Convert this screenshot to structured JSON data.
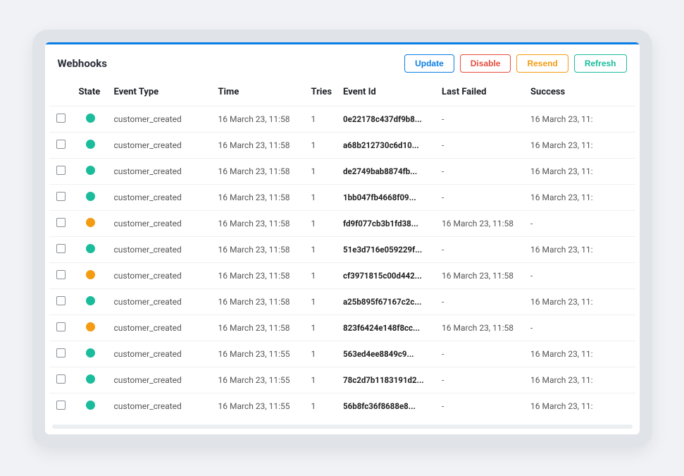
{
  "title": "Webhooks",
  "actions": {
    "update": "Update",
    "disable": "Disable",
    "resend": "Resend",
    "refresh": "Refresh"
  },
  "columns": {
    "state": "State",
    "event_type": "Event Type",
    "time": "Time",
    "tries": "Tries",
    "event_id": "Event Id",
    "last_failed": "Last Failed",
    "success": "Success"
  },
  "rows": [
    {
      "state": "teal",
      "event_type": "customer_created",
      "time": "16 March 23, 11:58",
      "tries": "1",
      "event_id": "0e22178c437df9b8...",
      "last_failed": "-",
      "success": "16 March 23, 11:"
    },
    {
      "state": "teal",
      "event_type": "customer_created",
      "time": "16 March 23, 11:58",
      "tries": "1",
      "event_id": "a68b212730c6d10...",
      "last_failed": "-",
      "success": "16 March 23, 11:"
    },
    {
      "state": "teal",
      "event_type": "customer_created",
      "time": "16 March 23, 11:58",
      "tries": "1",
      "event_id": "de2749bab8874fb...",
      "last_failed": "-",
      "success": "16 March 23, 11:"
    },
    {
      "state": "teal",
      "event_type": "customer_created",
      "time": "16 March 23, 11:58",
      "tries": "1",
      "event_id": "1bb047fb4668f09...",
      "last_failed": "-",
      "success": "16 March 23, 11:"
    },
    {
      "state": "orange",
      "event_type": "customer_created",
      "time": "16 March 23, 11:58",
      "tries": "1",
      "event_id": "fd9f077cb3b1fd38...",
      "last_failed": "16 March 23, 11:58",
      "success": "-"
    },
    {
      "state": "teal",
      "event_type": "customer_created",
      "time": "16 March 23, 11:58",
      "tries": "1",
      "event_id": "51e3d716e059229f...",
      "last_failed": "-",
      "success": "16 March 23, 11:"
    },
    {
      "state": "orange",
      "event_type": "customer_created",
      "time": "16 March 23, 11:58",
      "tries": "1",
      "event_id": "cf3971815c00d442...",
      "last_failed": "16 March 23, 11:58",
      "success": "-"
    },
    {
      "state": "teal",
      "event_type": "customer_created",
      "time": "16 March 23, 11:58",
      "tries": "1",
      "event_id": "a25b895f67167c2c...",
      "last_failed": "-",
      "success": "16 March 23, 11:"
    },
    {
      "state": "orange",
      "event_type": "customer_created",
      "time": "16 March 23, 11:58",
      "tries": "1",
      "event_id": "823f6424e148f8cc...",
      "last_failed": "16 March 23, 11:58",
      "success": "-"
    },
    {
      "state": "teal",
      "event_type": "customer_created",
      "time": "16 March 23, 11:55",
      "tries": "1",
      "event_id": "563ed4ee8849c9...",
      "last_failed": "-",
      "success": "16 March 23, 11:"
    },
    {
      "state": "teal",
      "event_type": "customer_created",
      "time": "16 March 23, 11:55",
      "tries": "1",
      "event_id": "78c2d7b1183191d2...",
      "last_failed": "-",
      "success": "16 March 23, 11:"
    },
    {
      "state": "teal",
      "event_type": "customer_created",
      "time": "16 March 23, 11:55",
      "tries": "1",
      "event_id": "56b8fc36f8688e8...",
      "last_failed": "-",
      "success": "16 March 23, 11:"
    }
  ],
  "state_colors": {
    "teal": "#1abc9c",
    "orange": "#f39c12"
  }
}
